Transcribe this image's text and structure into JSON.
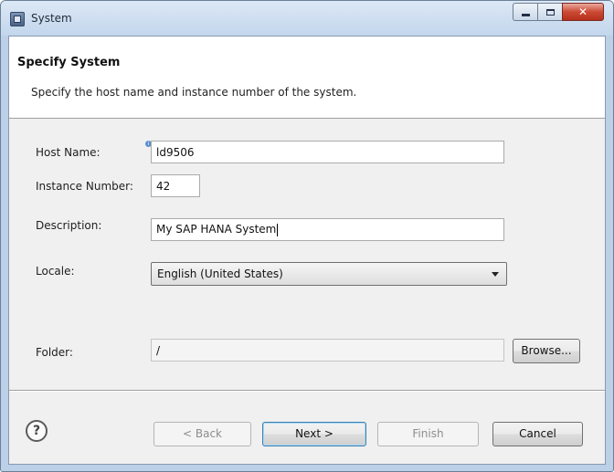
{
  "window": {
    "title": "System"
  },
  "header": {
    "title": "Specify System",
    "description": "Specify the host name and instance number of the system."
  },
  "form": {
    "host_name": {
      "label": "Host Name:",
      "value": "ld9506"
    },
    "instance_number": {
      "label": "Instance Number:",
      "value": "42"
    },
    "description": {
      "label": "Description:",
      "value": "My SAP HANA System"
    },
    "locale": {
      "label": "Locale:",
      "selected": "English (United States)"
    },
    "folder": {
      "label": "Folder:",
      "value": "/"
    }
  },
  "buttons": {
    "browse": "Browse...",
    "back": "< Back",
    "next": "Next >",
    "finish": "Finish",
    "cancel": "Cancel",
    "help": "?"
  },
  "colors": {
    "title_bar": "#c3d6ec",
    "close_button": "#cc4a35",
    "default_button_border": "#3c7fb1"
  }
}
